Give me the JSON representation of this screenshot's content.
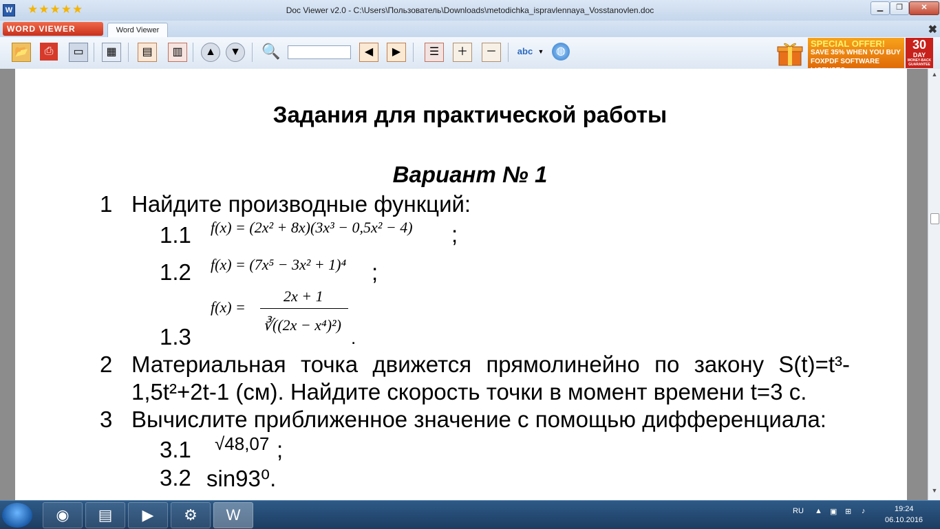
{
  "window": {
    "app_icon_letter": "W",
    "title": "Doc Viewer v2.0 - C:\\Users\\Пользователь\\Downloads\\metodichka_ispravlennaya_Vosstanovlen.doc",
    "rating_stars": "★★★★★",
    "minimize": "▁",
    "maximize": "❐",
    "close": "✕"
  },
  "tabs": {
    "logo": "WORD VIEWER",
    "active": "Word Viewer",
    "close": "✖"
  },
  "promo": {
    "line1": "SPECIAL OFFER!",
    "line2": "SAVE 35% WHEN YOU BUY",
    "line3": "FOXPDF SOFTWARE LICENSES.",
    "days": "30",
    "day_label": "DAY",
    "guarantee": "MONEY-BACK GUARANTEE"
  },
  "document": {
    "heading": "Задания для практической работы",
    "variant": "Вариант № 1",
    "task1": {
      "num": "1",
      "text": "Найдите производные функций:"
    },
    "sub1_1": {
      "num": "1.1",
      "formula": "f(x) = (2x² + 8x)(3x³ − 0,5x² − 4)",
      "tail": ";"
    },
    "sub1_2": {
      "num": "1.2",
      "formula": "f(x) = (7x⁵ − 3x² + 1)⁴",
      "tail": ";"
    },
    "sub1_3": {
      "num": "1.3",
      "lhs": "f(x) =",
      "numerator": "2x + 1",
      "denominator": "∛((2x − x⁴)²)",
      "tail": "."
    },
    "task2": {
      "num": "2",
      "line1": "Материальная точка движется прямолинейно по закону S(t)=t³-",
      "line2": "1,5t²+2t-1 (см). Найдите скорость точки в момент времени t=3 с."
    },
    "task3": {
      "num": "3",
      "text": "Вычислите приближенное значение с помощью дифференциала:"
    },
    "sub3_1": {
      "num": "3.1",
      "formula": "√48,07",
      "tail": ";"
    },
    "sub3_2": {
      "num": "3.2",
      "text": "sin93⁰."
    }
  },
  "taskbar": {
    "language": "RU",
    "time": "19:24",
    "date": "06.10.2016"
  }
}
